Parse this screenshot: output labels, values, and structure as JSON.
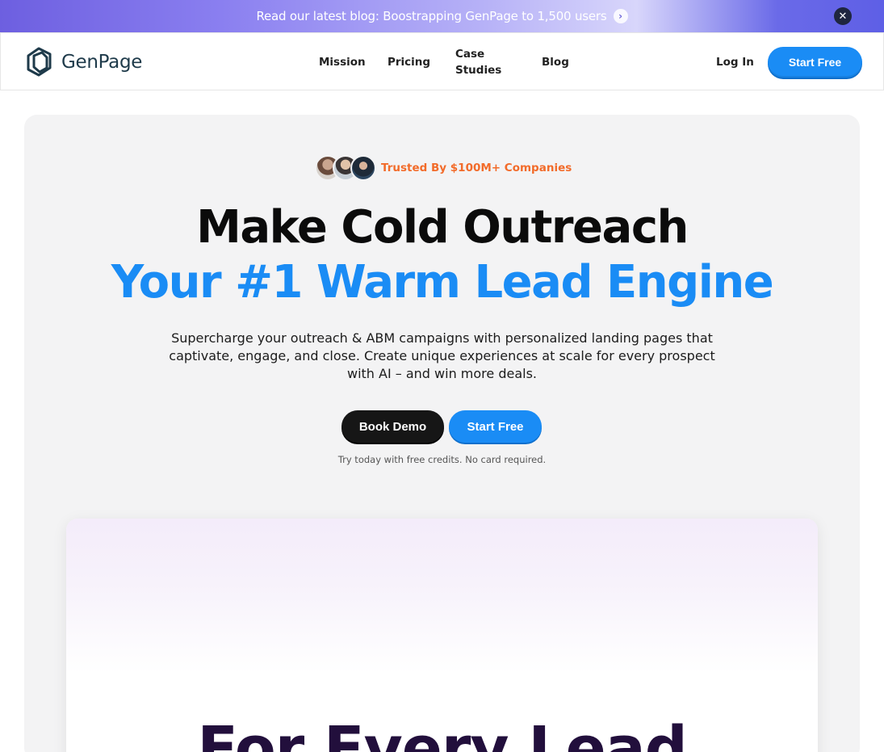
{
  "banner": {
    "text": "Read our latest blog: Boostrapping GenPage to 1,500 users",
    "arrow_icon": "chevron-right-icon",
    "close_icon": "close-icon"
  },
  "nav": {
    "logo_text": "GenPage",
    "links": [
      "Mission",
      "Pricing",
      "Case Studies",
      "Blog"
    ],
    "login": "Log In",
    "cta": "Start Free"
  },
  "hero": {
    "trusted_text": "Trusted By $100M+ Companies",
    "headline_line1": "Make Cold Outreach",
    "headline_line2": "Your #1 Warm Lead Engine",
    "subtext": "Supercharge your outreach & ABM campaigns with personalized landing pages that captivate, engage, and close. Create unique experiences at scale for every prospect with AI – and win more deals.",
    "book_demo": "Book Demo",
    "start_free": "Start Free",
    "note": "Try today with free credits. No card required."
  },
  "preview": {
    "title": "For Every Lead"
  },
  "colors": {
    "accent": "#1a8cf5",
    "trusted": "#f26b2a",
    "dark_button": "#161616",
    "preview_title": "#220f3c"
  }
}
